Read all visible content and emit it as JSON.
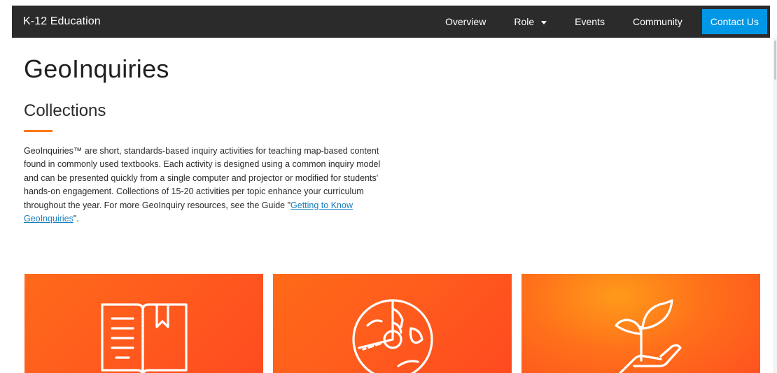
{
  "header": {
    "brand": "K-12 Education",
    "nav": {
      "overview": "Overview",
      "role": "Role",
      "events": "Events",
      "community": "Community",
      "contact": "Contact Us"
    }
  },
  "main": {
    "title": "GeoInquiries",
    "subtitle": "Collections",
    "intro_text": "GeoInquiries™ are short, standards-based inquiry activities for teaching map-based content found in commonly used textbooks. Each activity is designed using a common inquiry model and can be presented quickly from a single computer and projector or modified for students' hands-on engagement. Collections of 15-20 activities per topic enhance your curriculum throughout the year. For more GeoInquiry resources, see the Guide \"",
    "intro_link": "Getting to Know GeoInquiries",
    "intro_end": "\"."
  },
  "cards": [
    {
      "icon": "open-book-icon"
    },
    {
      "icon": "earth-cross-section-icon"
    },
    {
      "icon": "hand-with-sprout-icon"
    }
  ],
  "colors": {
    "nav_bg": "#2b2b2b",
    "contact_bg": "#0097e6",
    "accent": "#ff7a1a",
    "link": "#1a7fbf",
    "card_orange": "#ff5a1e"
  }
}
